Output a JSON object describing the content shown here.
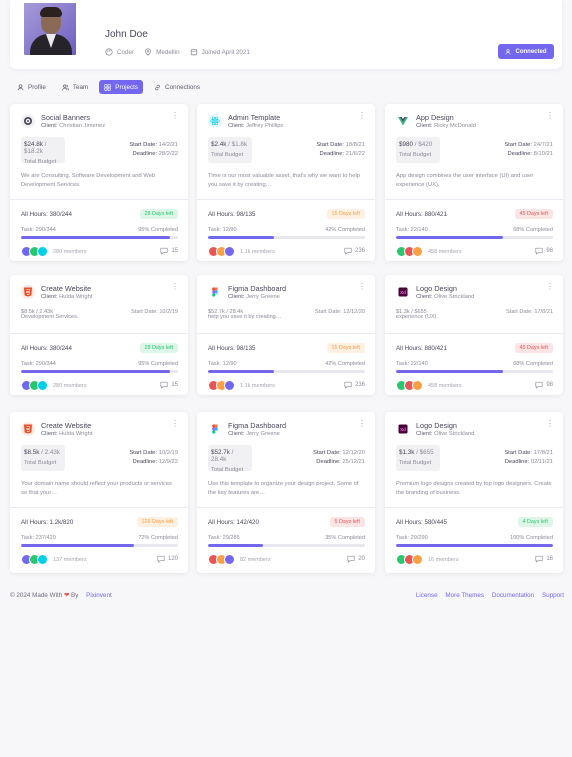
{
  "profile": {
    "name": "John Doe",
    "role": "Coder",
    "location": "Medellin",
    "joined": "Joined April 2021",
    "connected_label": "Connected"
  },
  "tabs": [
    {
      "label": "Profile",
      "icon": "user-icon"
    },
    {
      "label": "Team",
      "icon": "users-icon"
    },
    {
      "label": "Projects",
      "icon": "grid-icon",
      "active": true
    },
    {
      "label": "Connections",
      "icon": "link-icon"
    }
  ],
  "cards": [
    {
      "title": "Social Banners",
      "client_label": "Client:",
      "client": "Christian Jimenez",
      "logo": "social-logo-icon",
      "logo_bg": "#f1f0f2",
      "budget": "$24.8k",
      "budget_total": "/ $18.2k",
      "budget_label": "Total Budget",
      "start_label": "Start Date:",
      "start": "14/2/21",
      "deadline_label": "Deadline:",
      "deadline": "28/2/22",
      "desc": "We are Consulting, Software Development and Web Development Services.",
      "hours": "All Hours: 380/244",
      "badge": "28 Days left",
      "badge_color": "#28c76f",
      "badge_bg": "#ddf6e8",
      "task": "Task: 290/344",
      "completed": "95% Completed",
      "progress": 0.95,
      "members": "280 members",
      "comments": "15"
    },
    {
      "title": "Admin Template",
      "client_label": "Client:",
      "client": "Jeffrey Phillips",
      "logo": "react-logo-icon",
      "logo_bg": "#e8f8fc",
      "budget": "$2.4k",
      "budget_total": "/ $1.8k",
      "budget_label": "Total Budget",
      "start_label": "Start Date:",
      "start": "18/8/21",
      "deadline_label": "Deadline:",
      "deadline": "21/6/22",
      "desc": "Time is our most valuable asset, that's why we want to help you save it by creating…",
      "hours": "All Hours: 98/135",
      "badge": "15 Days left",
      "badge_color": "#ff9f43",
      "badge_bg": "#fff0e1",
      "task": "Task: 12/90",
      "completed": "42% Completed",
      "progress": 0.42,
      "members": "1.1k members",
      "comments": "236"
    },
    {
      "title": "App Design",
      "client_label": "Client:",
      "client": "Ricky McDonald",
      "logo": "vue-logo-icon",
      "logo_bg": "#ffffff",
      "budget": "$980",
      "budget_total": "/ $420",
      "budget_label": "Total Budget",
      "start_label": "Start Date:",
      "start": "24/7/21",
      "deadline_label": "Deadline:",
      "deadline": "8/10/21",
      "desc": "App design combines the user interface (UI) and user experience (UX).",
      "hours": "All Hours: 880/421",
      "badge": "45 Days left",
      "badge_color": "#ea5455",
      "badge_bg": "#fce4e4",
      "task": "Task: 22/140",
      "completed": "68% Completed",
      "progress": 0.68,
      "members": "458 members",
      "comments": "98"
    },
    {
      "title": "Create Website",
      "client_label": "Client:",
      "client": "Hulda Wright",
      "logo": "html5-logo-icon",
      "logo_bg": "#fde9e3",
      "ghost_left": "$8.5k / 2.43k",
      "ghost_desc": "Development Services.",
      "ghost_right": "Start Date: 10/2/19",
      "hours": "All Hours: 380/244",
      "badge": "28 Days left",
      "badge_color": "#28c76f",
      "badge_bg": "#ddf6e8",
      "task": "Task: 290/344",
      "completed": "95% Completed",
      "progress": 0.95,
      "members": "280 members",
      "comments": "15"
    },
    {
      "title": "Figma Dashboard",
      "client_label": "Client:",
      "client": "Jerry Greene",
      "logo": "figma-logo-icon",
      "logo_bg": "#ffffff",
      "ghost_left": "$52.7k / 28.4k",
      "ghost_desc": "help you save it by creating…",
      "ghost_right": "Start Date: 12/12/20",
      "hours": "All Hours: 98/135",
      "badge": "15 Days left",
      "badge_color": "#ff9f43",
      "badge_bg": "#fff0e1",
      "task": "Task: 12/90",
      "completed": "42% Completed",
      "progress": 0.42,
      "members": "1.1k members",
      "comments": "236"
    },
    {
      "title": "Logo Design",
      "client_label": "Client:",
      "client": "Olive Strickland",
      "logo": "xd-logo-icon",
      "logo_bg": "#ffffff",
      "ghost_left": "$1.3k / $655",
      "ghost_desc": "experience (UX).",
      "ghost_right": "Start Date: 17/8/21",
      "hours": "All Hours: 880/421",
      "badge": "45 Days left",
      "badge_color": "#ea5455",
      "badge_bg": "#fce4e4",
      "task": "Task: 22/140",
      "completed": "68% Completed",
      "progress": 0.68,
      "members": "458 members",
      "comments": "98"
    },
    {
      "title": "Create Website",
      "client_label": "Client:",
      "client": "Hulda Wright",
      "logo": "html5-logo-icon",
      "logo_bg": "#fde9e3",
      "budget": "$8.5k",
      "budget_total": "/ 2.43k",
      "budget_label": "Total Budget",
      "start_label": "Start Date:",
      "start": "10/2/19",
      "deadline_label": "Deadline:",
      "deadline": "12/9/22",
      "desc": "Your domain name should reflect your products or services so that your…",
      "hours": "All Hours: 1.2k/820",
      "badge": "126 Days left",
      "badge_color": "#ff9f43",
      "badge_bg": "#fff0e1",
      "task": "Task: 237/420",
      "completed": "72% Completed",
      "progress": 0.72,
      "members": "137 members",
      "comments": "120"
    },
    {
      "title": "Figma Dashboard",
      "client_label": "Client:",
      "client": "Jerry Greene",
      "logo": "figma-logo-icon",
      "logo_bg": "#ffffff",
      "budget": "$52.7k",
      "budget_total": "/ 28.4k",
      "budget_label": "Total Budget",
      "start_label": "Start Date:",
      "start": "12/12/20",
      "deadline_label": "Deadline:",
      "deadline": "25/12/21",
      "desc": "Use this template to organize your design project. Some of the key features are…",
      "hours": "All Hours: 142/420",
      "badge": "5 Days left",
      "badge_color": "#ea5455",
      "badge_bg": "#fce4e4",
      "task": "Task: 29/285",
      "completed": "35% Completed",
      "progress": 0.35,
      "members": "82 members",
      "comments": "20"
    },
    {
      "title": "Logo Design",
      "client_label": "Client:",
      "client": "Olive Strickland",
      "logo": "xd-logo-icon",
      "logo_bg": "#ffffff",
      "budget": "$1.3k",
      "budget_total": "/ $655",
      "budget_label": "Total Budget",
      "start_label": "Start Date:",
      "start": "17/8/21",
      "deadline_label": "Deadline:",
      "deadline": "02/11/21",
      "desc": "Premium logo designs created by top logo designers. Create the branding of business.",
      "hours": "All Hours: 580/445",
      "badge": "4 Days left",
      "badge_color": "#28c76f",
      "badge_bg": "#ddf6e8",
      "task": "Task: 29/290",
      "completed": "100% Completed",
      "progress": 1.0,
      "members": "16 members",
      "comments": "16"
    }
  ],
  "footer": {
    "copyright": "© 2024 Made With",
    "by": "By",
    "brand": "Pixinvent",
    "links": [
      "License",
      "More Themes",
      "Documentation",
      "Support"
    ]
  }
}
